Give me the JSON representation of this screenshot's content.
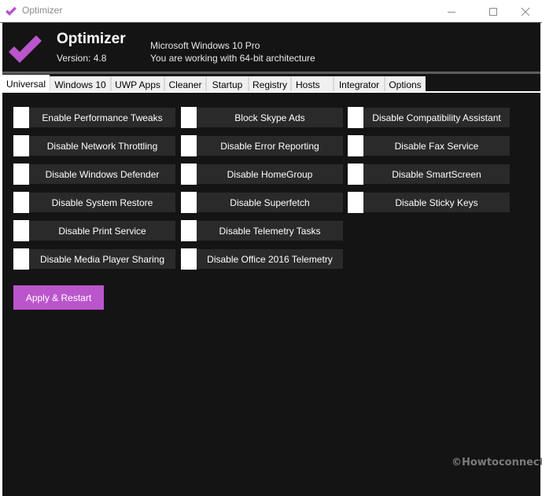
{
  "window": {
    "title": "Optimizer",
    "controls": {
      "minimize": "minimize",
      "maximize": "maximize",
      "close": "close"
    }
  },
  "header": {
    "app_name": "Optimizer",
    "version": "Version: 4.8",
    "os_name": "Microsoft Windows 10 Pro",
    "architecture": "You are working with 64-bit architecture",
    "logo_icon": "checkmark-icon"
  },
  "tabs": [
    {
      "label": "Universal",
      "active": true
    },
    {
      "label": "Windows 10",
      "active": false
    },
    {
      "label": "UWP Apps",
      "active": false
    },
    {
      "label": "Cleaner",
      "active": false
    },
    {
      "label": "Startup",
      "active": false
    },
    {
      "label": "Registry",
      "active": false
    },
    {
      "label": "Hosts",
      "active": false
    },
    {
      "label": "Integrator",
      "active": false
    },
    {
      "label": "Options",
      "active": false
    }
  ],
  "toggles": {
    "column1": [
      {
        "label": "Enable Performance Tweaks",
        "checked": false
      },
      {
        "label": "Disable Network Throttling",
        "checked": false
      },
      {
        "label": "Disable Windows Defender",
        "checked": false
      },
      {
        "label": "Disable System Restore",
        "checked": false
      },
      {
        "label": "Disable Print Service",
        "checked": false
      },
      {
        "label": "Disable Media Player Sharing",
        "checked": false
      }
    ],
    "column2": [
      {
        "label": "Block Skype Ads",
        "checked": false
      },
      {
        "label": "Disable Error Reporting",
        "checked": false
      },
      {
        "label": "Disable HomeGroup",
        "checked": false
      },
      {
        "label": "Disable Superfetch",
        "checked": false
      },
      {
        "label": "Disable Telemetry Tasks",
        "checked": false
      },
      {
        "label": "Disable Office 2016 Telemetry",
        "checked": false
      }
    ],
    "column3": [
      {
        "label": "Disable Compatibility Assistant",
        "checked": false
      },
      {
        "label": "Disable Fax Service",
        "checked": false
      },
      {
        "label": "Disable SmartScreen",
        "checked": false
      },
      {
        "label": "Disable Sticky Keys",
        "checked": false
      }
    ]
  },
  "actions": {
    "apply_label": "Apply & Restart"
  },
  "watermark": "©Howtoconnect",
  "colors": {
    "accent": "#bb55cc",
    "background": "#141414",
    "toggle_label_bg": "#2a2a2a",
    "toggle_box": "#ffffff"
  }
}
